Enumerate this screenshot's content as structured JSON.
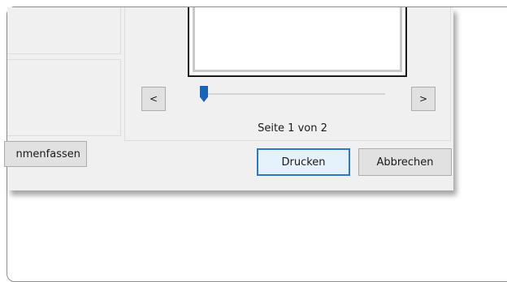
{
  "dialog": {
    "combine_button_label": "nmenfassen",
    "preview": {
      "prev_label": "<",
      "next_label": ">",
      "page_indicator": "Seite 1 von 2",
      "slider_value": 1,
      "slider_max": 2
    },
    "print_label": "Drucken",
    "cancel_label": "Abbrechen",
    "accent_color": "#1a63b7"
  }
}
